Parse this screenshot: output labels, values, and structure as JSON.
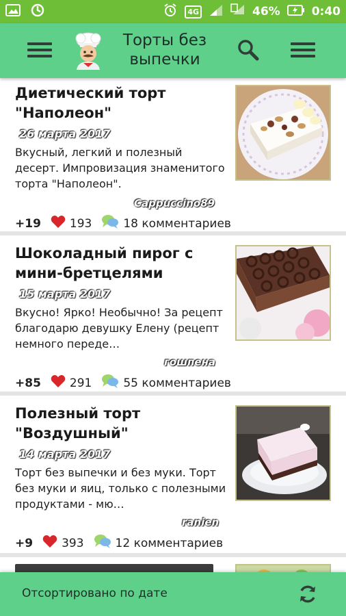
{
  "status_bar": {
    "network": "4G",
    "battery_percent": "46%",
    "time": "0:40"
  },
  "app_bar": {
    "title": "Торты без выпечки",
    "menu_icon": "hamburger-icon",
    "logo_icon": "chef-logo-icon",
    "search_icon": "search-icon",
    "more_icon": "hamburger-icon"
  },
  "recipes": [
    {
      "title": "Диетический торт \"Наполеон\"",
      "date": "26 марта 2017",
      "description": "Вкусный, легкий и полезный десерт. Импровизация знаменитого торта \"Наполеон\".",
      "author": "Cappuccino89",
      "rating": "+19",
      "likes": "193",
      "comments": "18 комментариев"
    },
    {
      "title": "Шоколадный пирог с мини-бретцелями",
      "date": "15 марта 2017",
      "description": "Вкусно! Ярко! Необычно! За рецепт благодарю девушку Елену (рецепт немного переде…",
      "author": "гошпена",
      "rating": "+85",
      "likes": "291",
      "comments": "55 комментариев"
    },
    {
      "title": "Полезный торт \"Воздушный\"",
      "date": "14 марта 2017",
      "description": "Торт без выпечки и без муки. Торт без муки и яиц, только с полезными продуктами - мю…",
      "author": "ranien",
      "rating": "+9",
      "likes": "393",
      "comments": "12 комментариев"
    }
  ],
  "bottom_bar": {
    "sort_label": "Отсортировано по дате",
    "refresh_icon": "refresh-icon"
  },
  "colors": {
    "status_bar": "#6fbe37",
    "app_bar": "#5fd08a",
    "heart": "#d9262a"
  }
}
